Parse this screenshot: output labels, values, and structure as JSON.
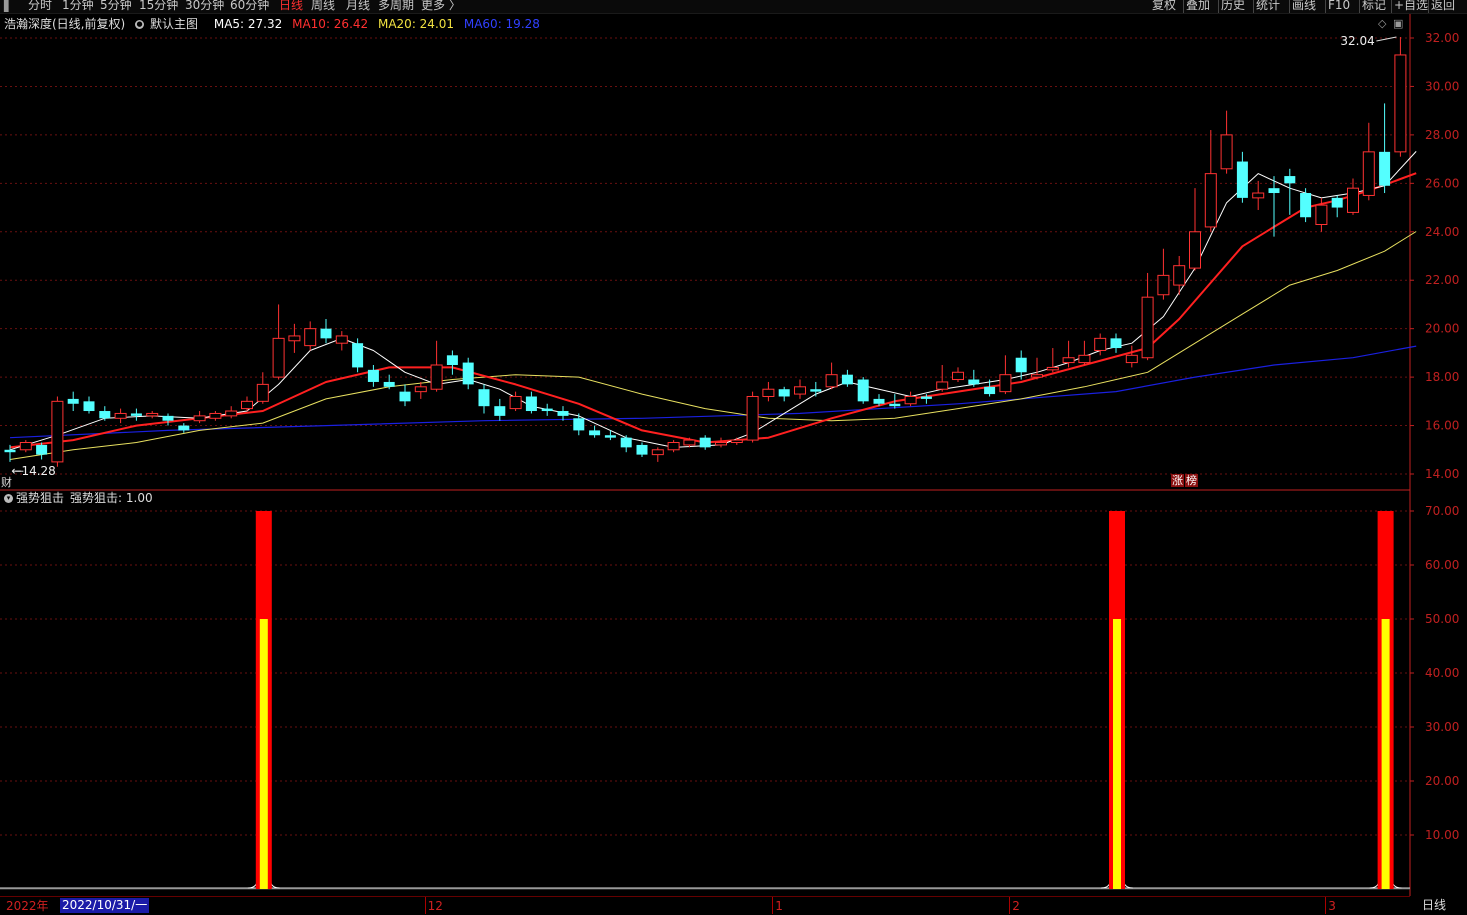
{
  "toolbar": {
    "periods": [
      "分时",
      "1分钟",
      "5分钟",
      "15分钟",
      "30分钟",
      "60分钟",
      "日线",
      "周线",
      "月线",
      "多周期",
      "更多 〉"
    ],
    "active_period": "日线",
    "right_buttons": [
      "复权",
      "叠加",
      "历史",
      "统计",
      "画线",
      "F10",
      "标记",
      "+自选",
      "返回"
    ]
  },
  "legend": {
    "stock": "浩瀚深度(日线,前复权)",
    "theme": "默认主图",
    "ma5": "MA5: 27.32",
    "ma10": "MA10: 26.42",
    "ma20": "MA20: 24.01",
    "ma60": "MA60: 19.28"
  },
  "indicator_legend": {
    "name": "强势狙击",
    "value": "强势狙击: 1.00"
  },
  "badges": {
    "cai": "财",
    "zhang": "涨",
    "bang": "榜"
  },
  "date_axis": {
    "year_label": "2022年",
    "cursor_label": "2022/10/31/一",
    "month_labels": [
      {
        "label": "12",
        "idx": 27
      },
      {
        "label": "1",
        "idx": 49
      },
      {
        "label": "2",
        "idx": 64
      },
      {
        "label": "3",
        "idx": 84
      }
    ]
  },
  "period_button": "日线",
  "colors": {
    "up": "#ff3232",
    "down": "#54ffff",
    "ma5": "#ffffff",
    "ma10": "#ff2020",
    "ma20": "#e8e060",
    "ma60": "#1a20e0",
    "axis": "#c02020",
    "grid": "#6a1010",
    "bar_red": "#ff0000",
    "bar_yellow": "#ffff00",
    "background": "#000000"
  },
  "chart_data": [
    {
      "type": "candlestick",
      "title": "",
      "ylim": [
        13.2,
        32.6
      ],
      "yticks": [
        "32.00",
        "30.00",
        "28.00",
        "26.00",
        "24.00",
        "22.00",
        "20.00",
        "18.00",
        "16.00",
        "14.00"
      ],
      "max_marker": "32.04",
      "min_marker": "14.28",
      "candles": [
        [
          15.0,
          14.9,
          15.2,
          14.5
        ],
        [
          15.0,
          15.3,
          15.4,
          14.9
        ],
        [
          15.2,
          14.8,
          15.3,
          14.6
        ],
        [
          14.5,
          17.0,
          17.2,
          14.3
        ],
        [
          17.1,
          16.9,
          17.4,
          16.6
        ],
        [
          17.0,
          16.6,
          17.2,
          16.5
        ],
        [
          16.6,
          16.3,
          16.8,
          16.2
        ],
        [
          16.3,
          16.5,
          16.7,
          16.1
        ],
        [
          16.5,
          16.4,
          16.7,
          16.2
        ],
        [
          16.4,
          16.5,
          16.6,
          16.3
        ],
        [
          16.4,
          16.2,
          16.5,
          16.0
        ],
        [
          16.0,
          15.8,
          16.1,
          15.7
        ],
        [
          16.2,
          16.4,
          16.6,
          16.1
        ],
        [
          16.3,
          16.5,
          16.6,
          16.2
        ],
        [
          16.4,
          16.6,
          16.8,
          16.3
        ],
        [
          16.7,
          17.0,
          17.2,
          16.6
        ],
        [
          17.0,
          17.7,
          18.2,
          16.9
        ],
        [
          18.0,
          19.6,
          21.0,
          17.9
        ],
        [
          19.5,
          19.7,
          20.2,
          19.0
        ],
        [
          19.3,
          20.0,
          20.3,
          19.1
        ],
        [
          20.0,
          19.6,
          20.4,
          19.4
        ],
        [
          19.4,
          19.7,
          19.9,
          19.1
        ],
        [
          19.4,
          18.4,
          19.6,
          18.2
        ],
        [
          18.3,
          17.8,
          18.5,
          17.6
        ],
        [
          17.8,
          17.6,
          18.1,
          17.5
        ],
        [
          17.4,
          17.0,
          17.7,
          16.8
        ],
        [
          17.4,
          17.6,
          17.8,
          17.1
        ],
        [
          17.5,
          18.5,
          19.5,
          17.4
        ],
        [
          18.9,
          18.5,
          19.1,
          18.1
        ],
        [
          18.6,
          17.7,
          18.8,
          17.5
        ],
        [
          17.5,
          16.8,
          17.7,
          16.5
        ],
        [
          16.8,
          16.4,
          17.1,
          16.2
        ],
        [
          16.7,
          17.2,
          17.4,
          16.6
        ],
        [
          17.2,
          16.6,
          17.4,
          16.5
        ],
        [
          16.7,
          16.6,
          16.9,
          16.4
        ],
        [
          16.6,
          16.4,
          16.8,
          16.2
        ],
        [
          16.3,
          15.8,
          16.5,
          15.6
        ],
        [
          15.8,
          15.6,
          16.0,
          15.5
        ],
        [
          15.6,
          15.5,
          15.8,
          15.4
        ],
        [
          15.5,
          15.1,
          15.6,
          14.9
        ],
        [
          15.2,
          14.8,
          15.3,
          14.7
        ],
        [
          14.8,
          15.0,
          15.1,
          14.5
        ],
        [
          15.0,
          15.3,
          15.4,
          14.9
        ],
        [
          15.2,
          15.4,
          15.5,
          15.1
        ],
        [
          15.5,
          15.1,
          15.6,
          15.0
        ],
        [
          15.2,
          15.3,
          15.5,
          15.1
        ],
        [
          15.3,
          15.4,
          15.5,
          15.2
        ],
        [
          15.4,
          17.2,
          17.4,
          15.3
        ],
        [
          17.2,
          17.5,
          17.8,
          17.0
        ],
        [
          17.5,
          17.2,
          17.6,
          17.0
        ],
        [
          17.3,
          17.6,
          17.9,
          17.1
        ],
        [
          17.5,
          17.4,
          17.8,
          17.2
        ],
        [
          17.6,
          18.1,
          18.6,
          17.5
        ],
        [
          18.1,
          17.7,
          18.3,
          17.6
        ],
        [
          17.9,
          17.0,
          18.0,
          16.9
        ],
        [
          17.1,
          16.9,
          17.3,
          16.8
        ],
        [
          16.9,
          16.8,
          17.3,
          16.7
        ],
        [
          16.9,
          17.2,
          17.4,
          16.8
        ],
        [
          17.2,
          17.1,
          17.3,
          16.9
        ],
        [
          17.5,
          17.8,
          18.5,
          17.4
        ],
        [
          17.9,
          18.2,
          18.4,
          17.8
        ],
        [
          17.9,
          17.7,
          18.3,
          17.6
        ],
        [
          17.6,
          17.3,
          17.9,
          17.2
        ],
        [
          17.4,
          18.1,
          18.9,
          17.3
        ],
        [
          18.8,
          18.2,
          19.1,
          17.9
        ],
        [
          18.0,
          18.1,
          18.8,
          17.9
        ],
        [
          18.3,
          18.4,
          19.2,
          18.2
        ],
        [
          18.6,
          18.8,
          19.5,
          18.4
        ],
        [
          18.6,
          18.9,
          19.5,
          18.5
        ],
        [
          19.1,
          19.6,
          19.8,
          18.9
        ],
        [
          19.6,
          19.2,
          19.8,
          19.0
        ],
        [
          18.6,
          18.9,
          19.3,
          18.4
        ],
        [
          18.8,
          21.3,
          22.3,
          18.7
        ],
        [
          21.4,
          22.2,
          23.3,
          21.2
        ],
        [
          21.8,
          22.6,
          23.0,
          21.4
        ],
        [
          22.5,
          24.0,
          25.8,
          22.4
        ],
        [
          24.2,
          26.4,
          28.2,
          24.0
        ],
        [
          26.6,
          28.0,
          29.0,
          26.4
        ],
        [
          26.9,
          25.4,
          27.3,
          25.2
        ],
        [
          25.4,
          25.6,
          26.1,
          24.9
        ],
        [
          25.8,
          25.6,
          26.3,
          23.8
        ],
        [
          26.3,
          26.0,
          26.6,
          24.7
        ],
        [
          25.6,
          24.6,
          25.8,
          24.4
        ],
        [
          24.3,
          25.1,
          25.4,
          24.0
        ],
        [
          25.4,
          25.0,
          25.5,
          24.6
        ],
        [
          24.8,
          25.8,
          26.2,
          24.7
        ],
        [
          25.5,
          27.3,
          28.5,
          25.3
        ],
        [
          27.3,
          25.9,
          29.3,
          25.6
        ],
        [
          27.3,
          31.3,
          32.04,
          27.1
        ]
      ],
      "ma5": [
        [
          0,
          15.0
        ],
        [
          3,
          15.6
        ],
        [
          6,
          16.3
        ],
        [
          9,
          16.4
        ],
        [
          12,
          16.3
        ],
        [
          15,
          16.6
        ],
        [
          17,
          17.7
        ],
        [
          19,
          19.1
        ],
        [
          21,
          19.6
        ],
        [
          23,
          19.1
        ],
        [
          25,
          18.2
        ],
        [
          27,
          17.7
        ],
        [
          29,
          17.9
        ],
        [
          31,
          17.5
        ],
        [
          33,
          16.8
        ],
        [
          36,
          16.4
        ],
        [
          39,
          15.5
        ],
        [
          42,
          15.1
        ],
        [
          45,
          15.2
        ],
        [
          47,
          15.7
        ],
        [
          49,
          16.5
        ],
        [
          51,
          17.3
        ],
        [
          53,
          17.8
        ],
        [
          55,
          17.5
        ],
        [
          57,
          17.2
        ],
        [
          59,
          17.5
        ],
        [
          61,
          17.7
        ],
        [
          63,
          17.9
        ],
        [
          65,
          18.2
        ],
        [
          67,
          18.6
        ],
        [
          69,
          19.1
        ],
        [
          71,
          19.4
        ],
        [
          73,
          20.5
        ],
        [
          75,
          22.5
        ],
        [
          77,
          25.2
        ],
        [
          79,
          26.4
        ],
        [
          81,
          25.8
        ],
        [
          83,
          25.4
        ],
        [
          85,
          25.6
        ],
        [
          87,
          25.9
        ],
        [
          89,
          27.32
        ]
      ],
      "ma10": [
        [
          0,
          15.1
        ],
        [
          4,
          15.4
        ],
        [
          8,
          16.0
        ],
        [
          12,
          16.3
        ],
        [
          16,
          16.6
        ],
        [
          20,
          17.8
        ],
        [
          24,
          18.4
        ],
        [
          28,
          18.4
        ],
        [
          32,
          17.7
        ],
        [
          36,
          16.9
        ],
        [
          40,
          15.8
        ],
        [
          44,
          15.3
        ],
        [
          48,
          15.5
        ],
        [
          52,
          16.3
        ],
        [
          56,
          17.0
        ],
        [
          60,
          17.4
        ],
        [
          64,
          17.8
        ],
        [
          68,
          18.5
        ],
        [
          72,
          19.2
        ],
        [
          74,
          20.4
        ],
        [
          76,
          21.9
        ],
        [
          78,
          23.4
        ],
        [
          80,
          24.2
        ],
        [
          82,
          25.0
        ],
        [
          84,
          25.3
        ],
        [
          86,
          25.7
        ],
        [
          89,
          26.42
        ]
      ],
      "ma20": [
        [
          0,
          14.6
        ],
        [
          4,
          15.0
        ],
        [
          8,
          15.3
        ],
        [
          12,
          15.8
        ],
        [
          16,
          16.1
        ],
        [
          20,
          17.1
        ],
        [
          24,
          17.6
        ],
        [
          28,
          17.9
        ],
        [
          32,
          18.1
        ],
        [
          36,
          18.0
        ],
        [
          40,
          17.3
        ],
        [
          44,
          16.7
        ],
        [
          48,
          16.3
        ],
        [
          52,
          16.2
        ],
        [
          56,
          16.3
        ],
        [
          60,
          16.7
        ],
        [
          64,
          17.1
        ],
        [
          68,
          17.6
        ],
        [
          72,
          18.2
        ],
        [
          75,
          19.4
        ],
        [
          78,
          20.6
        ],
        [
          81,
          21.8
        ],
        [
          84,
          22.4
        ],
        [
          87,
          23.2
        ],
        [
          89,
          24.01
        ]
      ],
      "ma60": [
        [
          0,
          15.5
        ],
        [
          10,
          15.8
        ],
        [
          20,
          16.0
        ],
        [
          30,
          16.2
        ],
        [
          40,
          16.3
        ],
        [
          50,
          16.5
        ],
        [
          60,
          16.9
        ],
        [
          70,
          17.4
        ],
        [
          75,
          18.0
        ],
        [
          80,
          18.5
        ],
        [
          85,
          18.8
        ],
        [
          89,
          19.28
        ]
      ]
    },
    {
      "type": "bar",
      "title": "强势狙击",
      "ylim": [
        0,
        70
      ],
      "yticks": [
        "70.00",
        "60.00",
        "50.00",
        "40.00",
        "30.00",
        "20.00",
        "10.00"
      ],
      "signal_indices": [
        16,
        70,
        87
      ],
      "red_value": 70,
      "yellow_value": 50
    }
  ]
}
